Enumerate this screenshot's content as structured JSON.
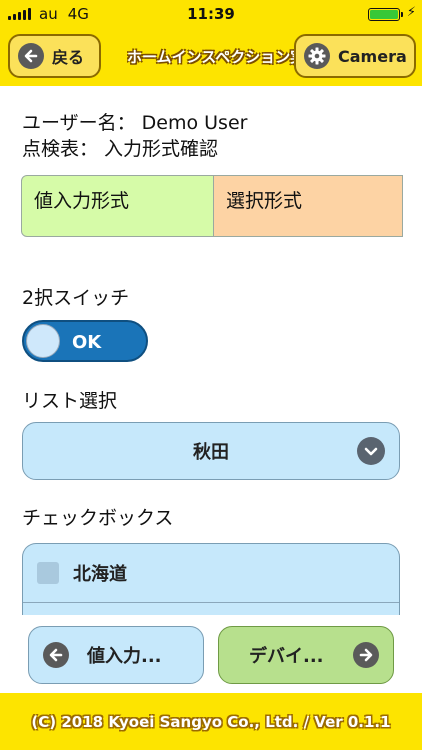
{
  "status_bar": {
    "carrier": "au",
    "network": "4G",
    "time": "11:39",
    "battery_level_percent": 100
  },
  "header": {
    "back_label": "戻る",
    "title": "ホームインスペクション実施",
    "camera_label": "Camera"
  },
  "info": {
    "user_line": "ユーザー名： Demo User",
    "checklist_line": "点検表： 入力形式確認"
  },
  "tabs": [
    {
      "label": "値入力形式",
      "color": "#d6fba8"
    },
    {
      "label": "選択形式",
      "color": "#fdd3a4"
    }
  ],
  "toggle": {
    "section_label": "2択スイッチ",
    "value": "OK",
    "on": true
  },
  "list_select": {
    "section_label": "リスト選択",
    "selected": "秋田"
  },
  "checkboxes": {
    "section_label": "チェックボックス",
    "items": [
      {
        "label": "北海道",
        "checked": false
      }
    ]
  },
  "bottom_nav": {
    "prev_label": "値入力...",
    "next_label": "デバイ..."
  },
  "footer": {
    "text": "(C) 2018 Kyoei Sangyo Co., Ltd. / Ver 0.1.1"
  },
  "icons": {
    "back": "arrow-left-icon",
    "camera": "gear-icon",
    "select": "chevron-down-icon",
    "prev": "arrow-left-icon",
    "next": "arrow-right-icon"
  },
  "colors": {
    "brand_yellow": "#fde400",
    "toggle_blue": "#1a74b8",
    "field_blue": "#c6e8fb",
    "next_green": "#b7e08d"
  }
}
